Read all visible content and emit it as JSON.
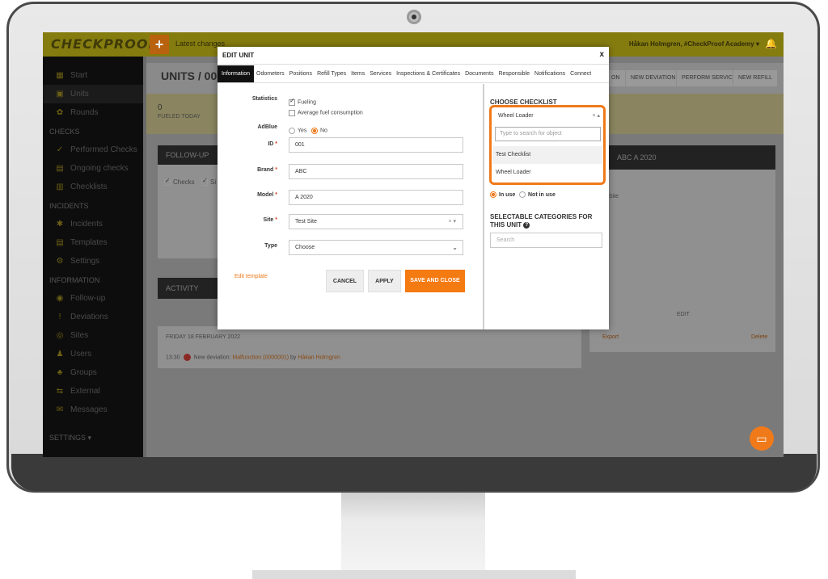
{
  "app": {
    "logo": "CHECKPROOF",
    "plus_glyph": "+",
    "latest_changes": "Latest changes",
    "user_label": "Håkan Holmgren, #CheckProof Academy ▾",
    "bell_glyph": "🔔"
  },
  "sidebar": {
    "items_top": [
      {
        "label": "Start",
        "icon": "▦"
      },
      {
        "label": "Units",
        "icon": "▣"
      },
      {
        "label": "Rounds",
        "icon": "✿"
      }
    ],
    "checks_header": "CHECKS",
    "checks_items": [
      {
        "label": "Performed Checks",
        "icon": "✓"
      },
      {
        "label": "Ongoing checks",
        "icon": "▤"
      },
      {
        "label": "Checklists",
        "icon": "▥"
      }
    ],
    "incidents_header": "INCIDENTS",
    "incidents_items": [
      {
        "label": "Incidents",
        "icon": "✱"
      },
      {
        "label": "Templates",
        "icon": "▤"
      },
      {
        "label": "Settings",
        "icon": "⚙"
      }
    ],
    "information_header": "INFORMATION",
    "information_items": [
      {
        "label": "Follow-up",
        "icon": "◉"
      },
      {
        "label": "Deviations",
        "icon": "!"
      },
      {
        "label": "Sites",
        "icon": "◎"
      },
      {
        "label": "Users",
        "icon": "♟"
      },
      {
        "label": "Groups",
        "icon": "♣"
      },
      {
        "label": "External",
        "icon": "⇆"
      },
      {
        "label": "Messages",
        "icon": "✉"
      }
    ],
    "settings_label": "SETTINGS ▾"
  },
  "background": {
    "units_title": "UNITS / 001.",
    "actions": [
      "ON",
      "NEW DEVIATION",
      "PERFORM SERVICE",
      "NEW REFILL"
    ],
    "fueled_count": "0",
    "fueled_label": "FUELED TODAY",
    "follow_up": "FOLLOW-UP",
    "checks_label": "Checks",
    "sites_short": "Si",
    "activity": "ACTIVITY",
    "right_panel_title": "ABC A 2020",
    "right_site_text": "Site",
    "edit_label": "EDIT",
    "export_label": "Export",
    "delete_label": "Delete",
    "date_line": "FRIDAY 18 FEBRUARY 2022",
    "log_time": "13:30",
    "log_text": "New deviation:",
    "log_link": "Malfunction (0000001)",
    "log_by": "by",
    "log_user": "Håkan Holmgren"
  },
  "modal": {
    "title": "EDIT UNIT",
    "close": "x",
    "tabs": [
      "Information",
      "Odometers",
      "Positions",
      "Refill Types",
      "Items",
      "Services",
      "Inspections & Certificates",
      "Documents",
      "Responsible",
      "Notifications",
      "Connect"
    ],
    "statistics_label": "Statistics",
    "fueling_label": "Fueling",
    "fuel_consumption_label": "Average fuel consumption",
    "adblue_label": "AdBlue",
    "yes_label": "Yes",
    "no_label": "No",
    "id_label": "ID",
    "id_value": "001",
    "brand_label": "Brand",
    "brand_value": "ABC",
    "model_label": "Model",
    "model_value": "A 2020",
    "site_label": "Site",
    "site_value": "Test Site",
    "type_label": "Type",
    "type_value": "Choose",
    "required_mark": "*",
    "edit_template": "Edit template",
    "cancel": "CANCEL",
    "apply": "APPLY",
    "save_close": "SAVE AND CLOSE",
    "choose_checklist": "CHOOSE CHECKLIST",
    "checklist_selected": "Wheel Loader",
    "clear_x": "×",
    "collapse_caret": "▴",
    "search_placeholder": "Type to search for object",
    "checklist_options": [
      "Test Checklist",
      "Wheel Loader"
    ],
    "in_use": "In use",
    "not_in_use": "Not in use",
    "categories_title": "SELECTABLE CATEGORIES FOR THIS UNIT",
    "categories_search": "Search"
  },
  "colors": {
    "accent": "#f07a1a",
    "brand_yellow": "#e8d21a",
    "sidebar": "#111111"
  }
}
